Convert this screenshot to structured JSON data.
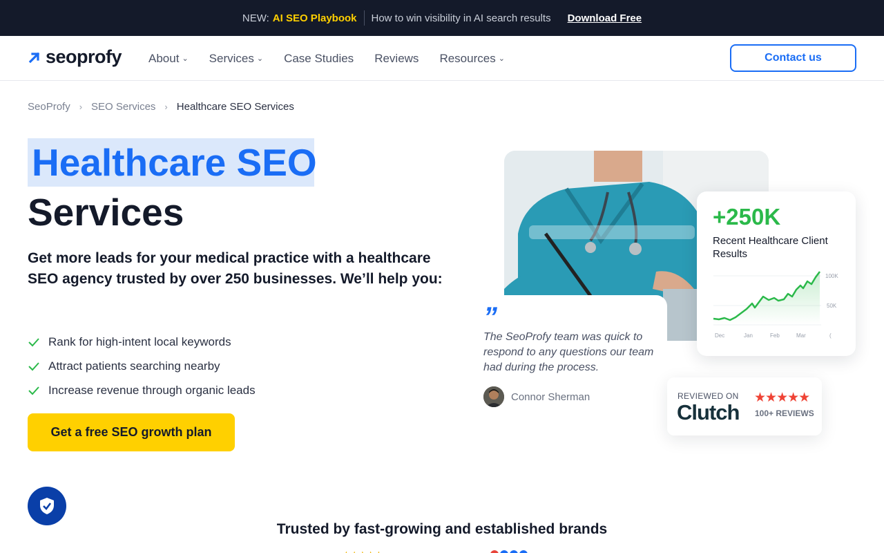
{
  "banner": {
    "new_label": "NEW:",
    "highlight": "AI SEO Playbook",
    "description": "How to win visibility in AI search results",
    "link": "Download Free"
  },
  "header": {
    "logo_text": "seoprofy",
    "nav": [
      {
        "label": "About",
        "dropdown": true
      },
      {
        "label": "Services",
        "dropdown": true
      },
      {
        "label": "Case Studies",
        "dropdown": false
      },
      {
        "label": "Reviews",
        "dropdown": false
      },
      {
        "label": "Resources",
        "dropdown": true
      }
    ],
    "contact_label": "Contact us"
  },
  "breadcrumb": [
    "SeoProfy",
    "SEO Services",
    "Healthcare SEO Services"
  ],
  "hero": {
    "title_highlight": "Healthcare SEO",
    "title_rest": "Services",
    "lead": "Get more leads for your medical practice with a healthcare SEO agency trusted by over 250 businesses. We’ll help you:",
    "bullets": [
      "Rank for high-intent local keywords",
      "Attract patients searching nearby",
      "Increase revenue through organic leads"
    ],
    "cta": "Get a free SEO growth plan"
  },
  "stat_card": {
    "value": "+250K",
    "label": "Recent Healthcare Client Results",
    "y_ticks": [
      "100K",
      "50K"
    ],
    "x_ticks": [
      "Dec",
      "Jan",
      "Feb",
      "Mar",
      "("
    ]
  },
  "testimonial": {
    "quote_mark": "”",
    "text": "The SeoProfy team was quick to respond to any questions our team had during the process.",
    "author": "Connor Sherman"
  },
  "clutch": {
    "reviewed_on": "REVIEWED ON",
    "brand": "Clutch",
    "stars": "★★★★★",
    "reviews": "100+ REVIEWS"
  },
  "trusted_heading": "Trusted by fast-growing and established brands",
  "colors": {
    "accent": "#1a6df5",
    "cta": "#ffd000",
    "dark": "#141a2a",
    "success": "#2bb94a",
    "clutch_red": "#ef4335"
  }
}
